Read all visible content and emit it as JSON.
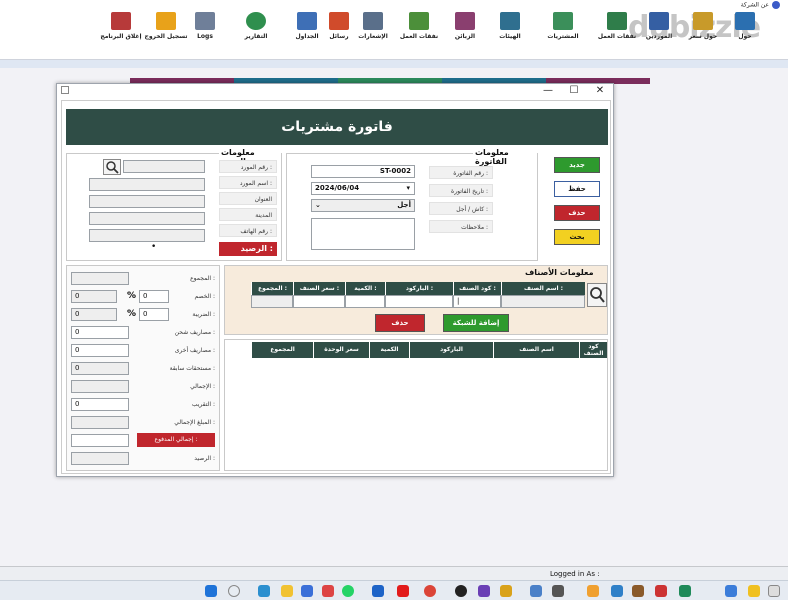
{
  "toolbar": {
    "about": "عن الشركة",
    "items": [
      {
        "label": "إغلاق البرنامج",
        "color": "#b73a3a"
      },
      {
        "label": "تسجيل الخروج",
        "color": "#e8a21a"
      },
      {
        "label": "Logs",
        "color": "#6f7f99"
      },
      {
        "label": "التقارير",
        "color": "#2f8f4e"
      },
      {
        "label": "الجداول",
        "color": "#3e6fb6"
      },
      {
        "label": "رسائل",
        "color": "#d04b2b"
      },
      {
        "label": "الإشعارات",
        "color": "#5a6f8a"
      },
      {
        "label": "نفقات العمل",
        "color": "#4c8f3a"
      },
      {
        "label": "الزبائن",
        "color": "#8a3f6f"
      },
      {
        "label": "الهيئات",
        "color": "#2f6f8f"
      },
      {
        "label": "المشتريات",
        "color": "#3b8f5a"
      },
      {
        "label": "نفقات العمل",
        "color": "#2f7d4a"
      },
      {
        "label": "الموردين",
        "color": "#355fa3"
      },
      {
        "label": "حول سعر",
        "color": "#c89a2a"
      },
      {
        "label": "حول",
        "color": "#2b6fb0"
      }
    ]
  },
  "watermark": "dubizzle",
  "window": {
    "title": "فاتورة مشتريات",
    "controls": {
      "minimize": "—",
      "maximize": "☐",
      "close": "✕"
    }
  },
  "supplier": {
    "section_title": "معلومات المورد",
    "labels": [
      "رقم المورد :",
      "اسم المورد :",
      "العنوان",
      "المدينة",
      "رقم الهاتف :"
    ],
    "balance_label": "الرصيد :",
    "dot": "•"
  },
  "invoice": {
    "section_title": "معلومات الفاتورة",
    "labels": [
      "رقم الفاتورة :",
      "تاريخ الفاتورة :",
      "كاش / أجل :",
      "ملاحظات :"
    ],
    "number": "ST-0002",
    "date": "2024/06/04",
    "payment": "أجل"
  },
  "actions": {
    "new": "جديد",
    "save": "حفظ",
    "delete": "حذف",
    "search": "بحث"
  },
  "totals": {
    "labels": [
      "المجموع :",
      "الخصم :",
      "الضريبة :",
      "مصاريف شحن :",
      "مصاريف أخرى :",
      "مستحقات سابقة :",
      "الإجمالي :",
      "التقريب :",
      "المبلغ الإجمالي :",
      "إجمالي المدفوع :",
      "الرصيد :"
    ],
    "discount": "0",
    "discount_pct": "0",
    "tax": "0",
    "tax_pct": "0",
    "shipping": "0",
    "other": "0",
    "previous": "0",
    "rounding": "0",
    "percent": "%"
  },
  "items": {
    "section_title": "معلومات الأصناف",
    "headers": [
      "كود الصنف :",
      "اسم الصنف :",
      "الباركود :",
      "الكمية :",
      "سعر الصنف :",
      "المجموع :"
    ],
    "add_button": "إضافة للشبكة",
    "delete_button": "حذف"
  },
  "grid": {
    "headers": [
      "كود الصنف",
      "اسم الصنف",
      "الباركود",
      "الكمية",
      "سعر الوحدة",
      "المجموع"
    ]
  },
  "status": {
    "logged_in": "Logged in As :"
  },
  "taskbar": {
    "apps": [
      "start-icon",
      "search-icon",
      "edge-icon",
      "explorer-icon",
      "store-icon",
      "whatsapp-icon",
      "chrome-icon",
      "folder-icon",
      "youtube-icon",
      "mail-icon",
      "app-icon",
      "photos-icon",
      "music-icon",
      "camera-icon",
      "settings-icon",
      "terminal-icon",
      "notes-icon",
      "calc-icon",
      "paint-icon",
      "tool-icon"
    ]
  }
}
